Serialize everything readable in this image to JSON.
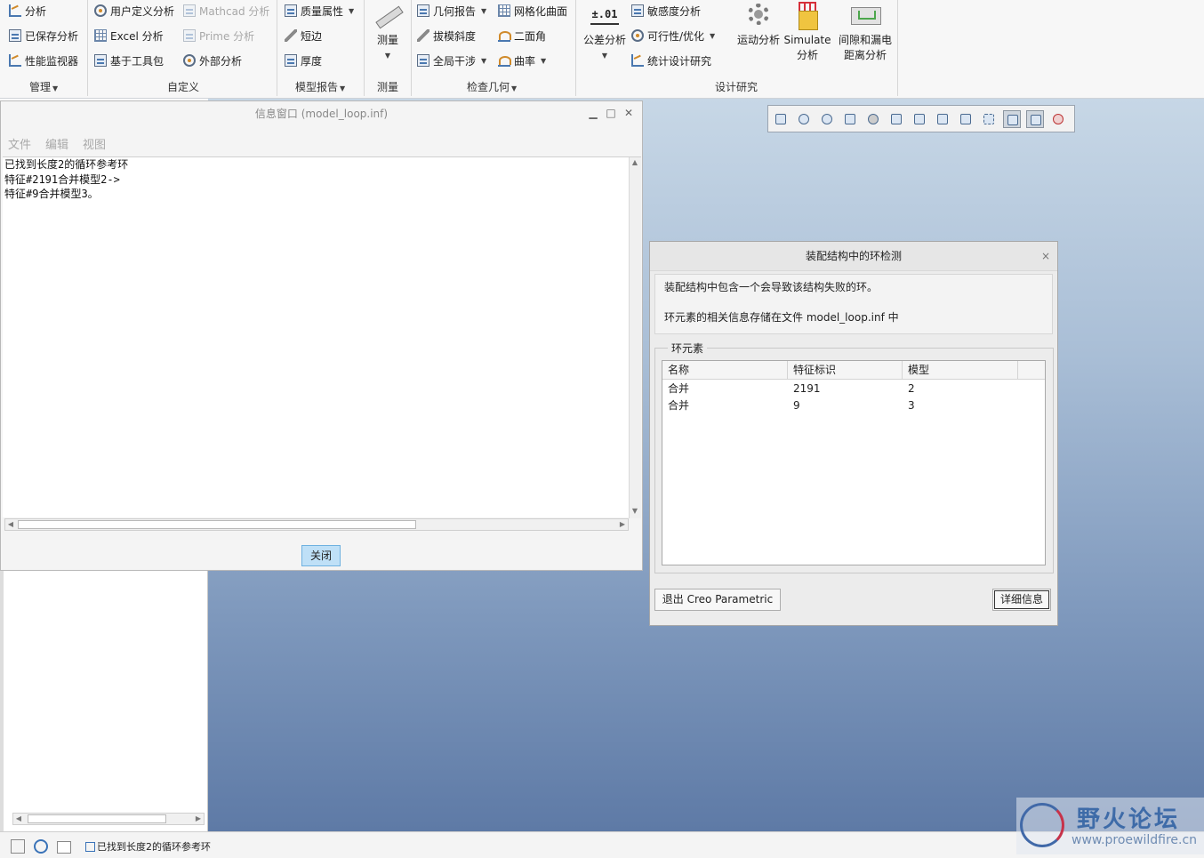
{
  "ribbon": {
    "manage": {
      "items": [
        "分析",
        "已保存分析",
        "性能监视器"
      ],
      "group_label": "管理"
    },
    "custom": {
      "items": [
        "用户定义分析",
        "Mathcad 分析",
        "Excel 分析",
        "Prime 分析",
        "基于工具包",
        "外部分析"
      ],
      "group_label": "自定义"
    },
    "model_report": {
      "items": [
        "质量属性",
        "短边",
        "厚度"
      ],
      "group_label": "模型报告"
    },
    "measure": {
      "button": "测量",
      "group_label": "测量"
    },
    "inspect": {
      "items": [
        "几何报告",
        "网格化曲面",
        "拔模斜度",
        "二面角",
        "全局干涉",
        "曲率"
      ],
      "group_label": "检查几何"
    },
    "design": {
      "tolerance_icon_text": "±.01",
      "tolerance": "公差分析",
      "items": [
        "敏感度分析",
        "可行性/优化",
        "统计设计研究"
      ],
      "motion": "运动分析",
      "simulate": [
        "Simulate",
        "分析"
      ],
      "clearance": [
        "间隙和漏电",
        "距离分析"
      ],
      "group_label": "设计研究"
    }
  },
  "info_window": {
    "title": "信息窗口 (model_loop.inf)",
    "menu": [
      "文件",
      "编辑",
      "视图"
    ],
    "lines": [
      "已找到长度2的循环参考环",
      "特征#2191合并模型2->",
      "特征#9合并模型3。"
    ],
    "close_label": "关闭"
  },
  "dialog": {
    "title": "装配结构中的环检测",
    "close": "×",
    "message": [
      "装配结构中包含一个会导致该结构失败的环。",
      "环元素的相关信息存储在文件 model_loop.inf 中"
    ],
    "group_label": "环元素",
    "columns": [
      "名称",
      "特征标识",
      "模型"
    ],
    "rows": [
      [
        "合并",
        "2191",
        "2"
      ],
      [
        "合并",
        "9",
        "3"
      ]
    ],
    "exit_label": "退出 Creo Parametric",
    "details_label": "详细信息"
  },
  "status": {
    "message": "已找到长度2的循环参考环"
  },
  "watermark": {
    "name": "野火论坛",
    "url": "www.proewildfire.cn"
  },
  "colors": {
    "accent": "#6fb1e0",
    "close_button_bg": "#bfe0f7",
    "viewport_top": "#c7d7e6",
    "viewport_bottom": "#5e7aa6"
  }
}
